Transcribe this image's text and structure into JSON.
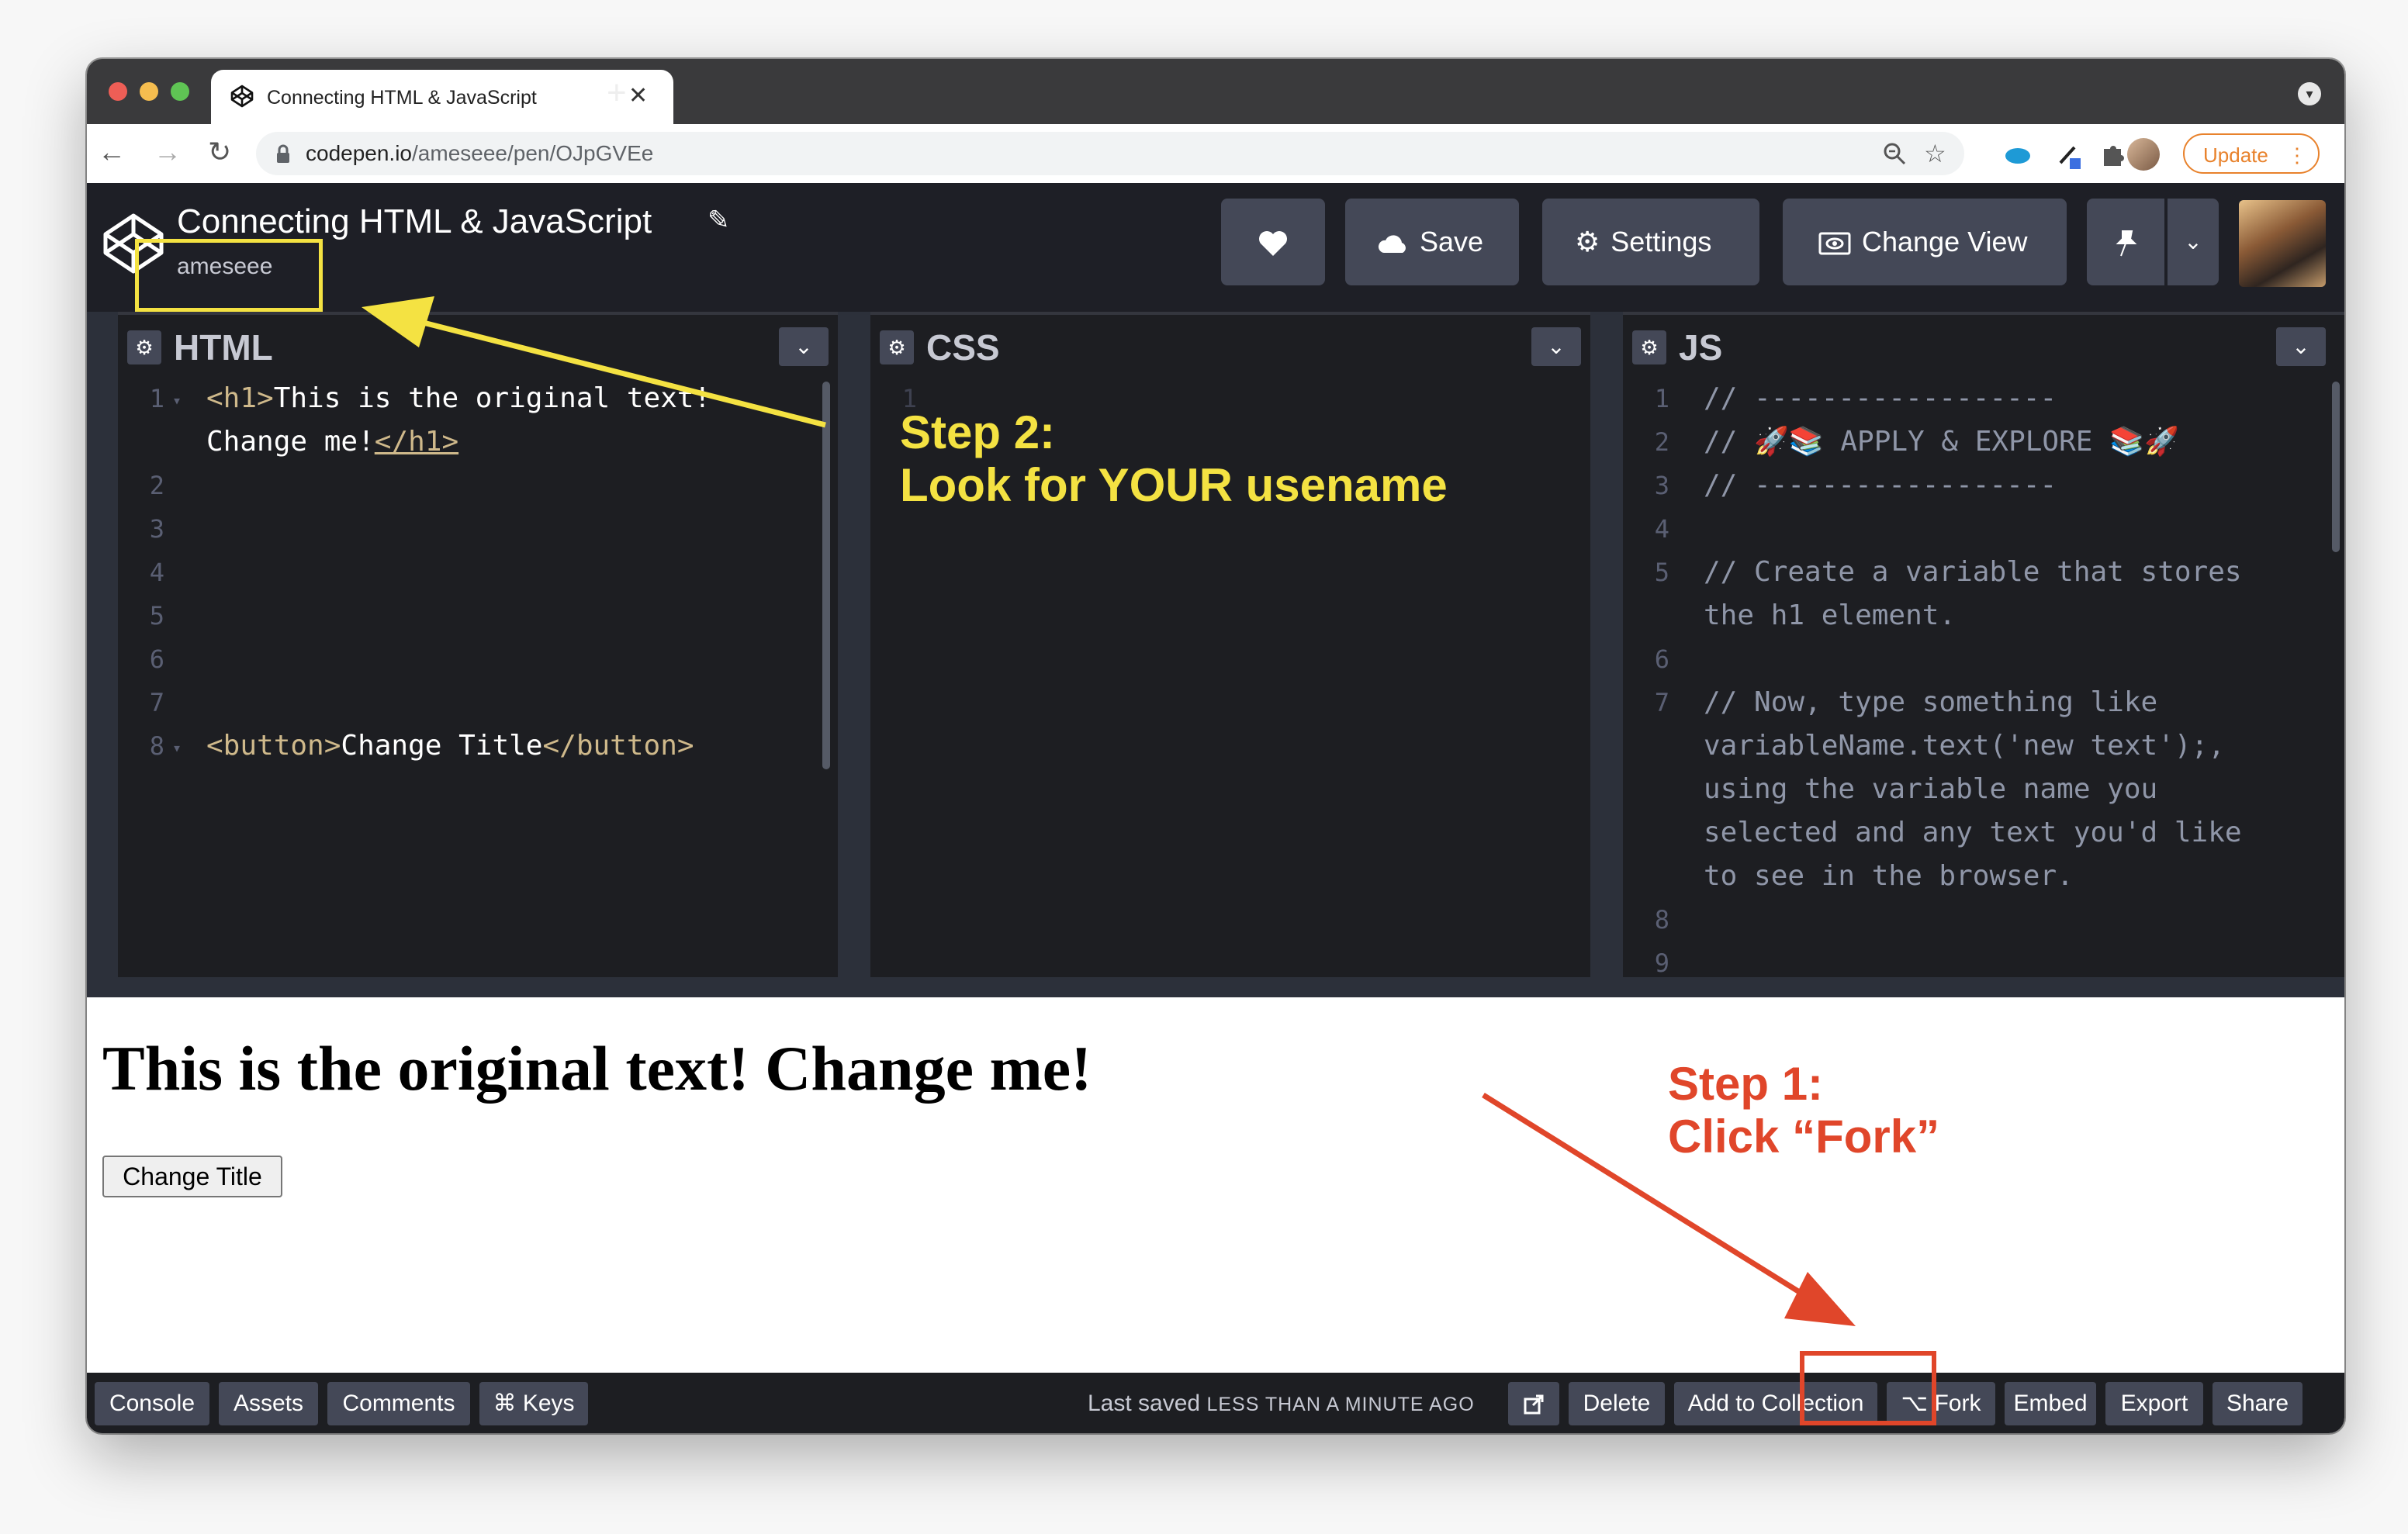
{
  "browser": {
    "tab_title": "Connecting HTML & JavaScript",
    "tab_close": "✕",
    "new_tab": "+",
    "url_host": "codepen.io",
    "url_path": "/ameseee/pen/OJpGVEe",
    "update_label": "Update",
    "update_menu": "⋮"
  },
  "codepen": {
    "pen_title": "Connecting HTML & JavaScript",
    "username": "ameseee",
    "buttons": {
      "save": "Save",
      "settings": "Settings",
      "change_view": "Change View"
    }
  },
  "panels": {
    "html": {
      "name": "HTML",
      "lines": [
        {
          "num": "1",
          "open": "<h1>",
          "text": "This is the original text!",
          "close": ""
        },
        {
          "num": "",
          "open": "",
          "text": "Change me!",
          "close": "</h1>"
        },
        {
          "num": "2"
        },
        {
          "num": "3"
        },
        {
          "num": "4"
        },
        {
          "num": "5"
        },
        {
          "num": "6"
        },
        {
          "num": "7"
        },
        {
          "num": "8",
          "open": "<button>",
          "text": "Change Title",
          "close": "</button>"
        }
      ]
    },
    "css": {
      "name": "CSS",
      "line_num": "1"
    },
    "js": {
      "name": "JS",
      "lines": [
        {
          "num": "1",
          "text": "// ------------------"
        },
        {
          "num": "2",
          "text": "// 🚀📚 APPLY & EXPLORE 📚🚀"
        },
        {
          "num": "3",
          "text": "// ------------------"
        },
        {
          "num": "4",
          "text": ""
        },
        {
          "num": "5",
          "text": "// Create a variable that stores"
        },
        {
          "num": "",
          "text": "the h1 element."
        },
        {
          "num": "6",
          "text": ""
        },
        {
          "num": "7",
          "text": "// Now, type something like"
        },
        {
          "num": "",
          "text": "variableName.text('new text');,"
        },
        {
          "num": "",
          "text": "using the variable name you"
        },
        {
          "num": "",
          "text": "selected and any text you'd like"
        },
        {
          "num": "",
          "text": "to see in the browser."
        },
        {
          "num": "8",
          "text": ""
        },
        {
          "num": "9",
          "text": ""
        }
      ]
    }
  },
  "preview": {
    "heading": "This is the original text! Change me!",
    "button": "Change Title"
  },
  "footer": {
    "console": "Console",
    "assets": "Assets",
    "comments": "Comments",
    "keys": "⌘ Keys",
    "last_saved_label": "Last saved",
    "last_saved_time": "LESS THAN A MINUTE AGO",
    "delete": "Delete",
    "add_to_collection": "Add to Collection",
    "fork": "⌥ Fork",
    "embed": "Embed",
    "export": "Export",
    "share": "Share"
  },
  "annotations": {
    "step2_line1": "Step 2:",
    "step2_line2": "Look for YOUR usename",
    "step1_line1": "Step 1:",
    "step1_line2": "Click “Fork”",
    "colors": {
      "step2": "#f4e242",
      "step1": "#e0462a"
    }
  },
  "icons": [
    "close-light",
    "minimize-light",
    "maximize-light",
    "codepen-logo-icon",
    "lock-icon",
    "zoom-icon",
    "star-icon",
    "puzzle-icon",
    "heart-icon",
    "cloud-icon",
    "gear-icon",
    "eye-icon",
    "pin-icon",
    "chevron-down-icon",
    "external-link-icon"
  ]
}
